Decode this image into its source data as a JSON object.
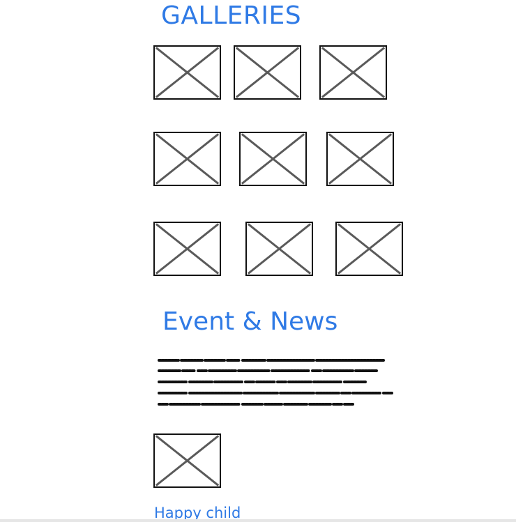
{
  "galleries": {
    "title": "GALLERIES",
    "image_count": 9
  },
  "news": {
    "title": "Event & News",
    "text_placeholder_lines": 5
  },
  "featured": {
    "caption": "Happy child"
  },
  "colors": {
    "heading": "#2f7ae5",
    "placeholder_border": "#111111",
    "placeholder_cross": "#5a5a5a",
    "scribble": "#111111"
  },
  "icons": {
    "image_placeholder": "image-placeholder-icon",
    "text_placeholder": "text-placeholder-lines"
  }
}
